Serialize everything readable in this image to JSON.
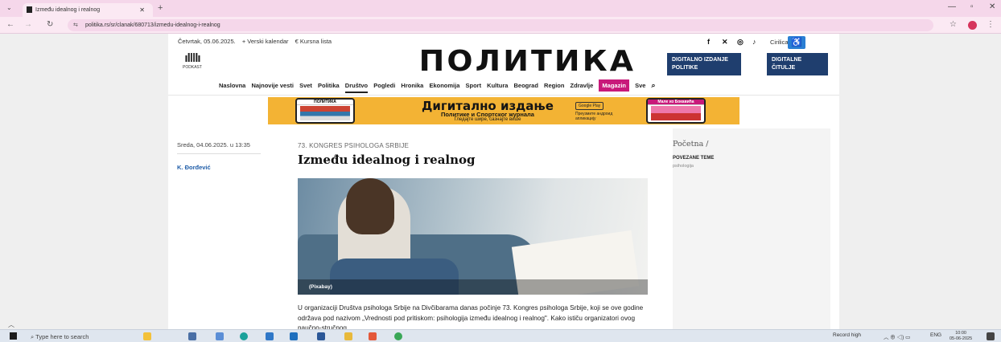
{
  "browser": {
    "tab_title": "Između idealnog i realnog",
    "url": "politika.rs/sr/clanak/680713/izmedu-idealnog-i-realnog"
  },
  "site": {
    "date_line": "Četvrtak, 05.06.2025.",
    "topbar_links": [
      "+ Verski kalendar",
      "€ Kursna lista"
    ],
    "podcast_label": "PODKAST",
    "logo_text": "ПОЛИТИКА",
    "script_toggle": "Cirilica",
    "promo_left": "DIGITALNO IZDANJE POLITIKE",
    "promo_right": "DIGITALNE ČITULJE",
    "nav": [
      "Naslovna",
      "Najnovije vesti",
      "Svet",
      "Politika",
      "Društvo",
      "Pogledi",
      "Hronika",
      "Ekonomija",
      "Sport",
      "Kultura",
      "Beograd",
      "Region",
      "Zdravlje",
      "Magazin",
      "Sve"
    ],
    "nav_active": "Društvo"
  },
  "banner": {
    "title": "Дигитално издање",
    "subtitle": "Политике и Спортског журнала",
    "tagline": "Гледајте шире, сазнајте више",
    "store_badge": "Google Play",
    "store_text": "Преузмите андроид апликацију",
    "phone_left_title": "ПОЛИТИКА",
    "phone_right_title": "Мале из Бокавића"
  },
  "article": {
    "date": "Sreda, 04.06.2025. u 13:35",
    "author": "K. Đorđević",
    "kicker": "73. KONGRES PSIHOLOGA SRBIJE",
    "title": "Između idealnog i realnog",
    "photo_credit": "(Pixabay)",
    "body": "U organizaciji Društva psihologa Srbije na Divčibarama danas počinje 73. Kongres psihologa Srbije, koji se ove godine održava pod nazivom „Vrednosti pod pritiskom: psihologija između idealnog i realnog\". Kako ističu organizatori ovog naučno-stručnog"
  },
  "sidebar": {
    "breadcrumb": "Početna  /",
    "related_heading": "POVEZANE TEME",
    "related_tag": "psihologija"
  },
  "taskbar": {
    "search_placeholder": "Type here to search",
    "notification": "Record high",
    "language": "ENG",
    "time": "10:00",
    "date": "05-06-2025"
  },
  "colors": {
    "tab_strip": "#f5d7ea",
    "promo_blue": "#1f3e6e",
    "magazin_pink": "#c8197a",
    "banner_yellow": "#f3b334",
    "author_blue": "#1f5da8"
  }
}
